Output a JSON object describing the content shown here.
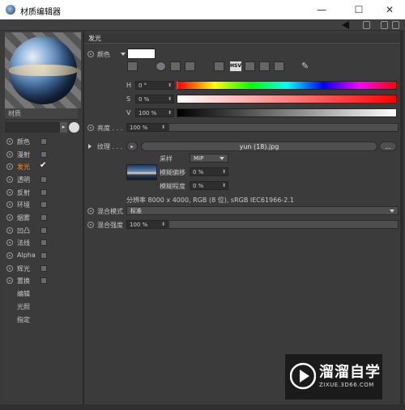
{
  "window": {
    "title": "材质编辑器",
    "buttons": {
      "minimize": "—",
      "maximize": "☐",
      "close": "✕"
    }
  },
  "left": {
    "material_name": "材质",
    "channels": [
      {
        "label": "颜色",
        "checked": false,
        "active": false
      },
      {
        "label": "漫射",
        "checked": false,
        "active": false
      },
      {
        "label": "发光",
        "checked": true,
        "active": true
      },
      {
        "label": "透明",
        "checked": false,
        "active": false
      },
      {
        "label": "反射",
        "checked": false,
        "active": false
      },
      {
        "label": "环境",
        "checked": false,
        "active": false
      },
      {
        "label": "烟雾",
        "checked": false,
        "active": false
      },
      {
        "label": "凹凸",
        "checked": false,
        "active": false
      },
      {
        "label": "法线",
        "checked": false,
        "active": false
      },
      {
        "label": "Alpha",
        "checked": false,
        "active": false
      },
      {
        "label": "辉光",
        "checked": false,
        "active": false
      },
      {
        "label": "置换",
        "checked": false,
        "active": false
      }
    ],
    "extras": [
      "编辑",
      "光照",
      "指定"
    ]
  },
  "panel": {
    "section_title": "发光",
    "color_label": "颜色",
    "color_mode": "HSV",
    "h_label": "H",
    "h_value": "0 °",
    "s_label": "S",
    "s_value": "0 %",
    "v_label": "V",
    "v_value": "100 %",
    "brightness_label": "亮度 . . .",
    "brightness_value": "100 %",
    "texture_label": "纹理 . . .",
    "texture_file": "yun (18).jpg",
    "texture_more": "...",
    "sampling_label": "采样",
    "sampling_value": "MIP",
    "blur_offset_label": "模糊偏移",
    "blur_offset_value": "0 %",
    "blur_scale_label": "模糊程度",
    "blur_scale_value": "0 %",
    "resolution_text": "分辨率 8000 x 4000, RGB (8 位), sRGB IEC61966-2.1",
    "mix_mode_label": "混合模式",
    "mix_mode_value": "标准",
    "mix_strength_label": "混合强度",
    "mix_strength_value": "100 %"
  },
  "watermark": {
    "brand": "溜溜自学",
    "url": "ZIXUE.3D66.COM"
  },
  "colors": {
    "accent": "#ff8a2a",
    "panel_bg": "#3b3b3b"
  }
}
